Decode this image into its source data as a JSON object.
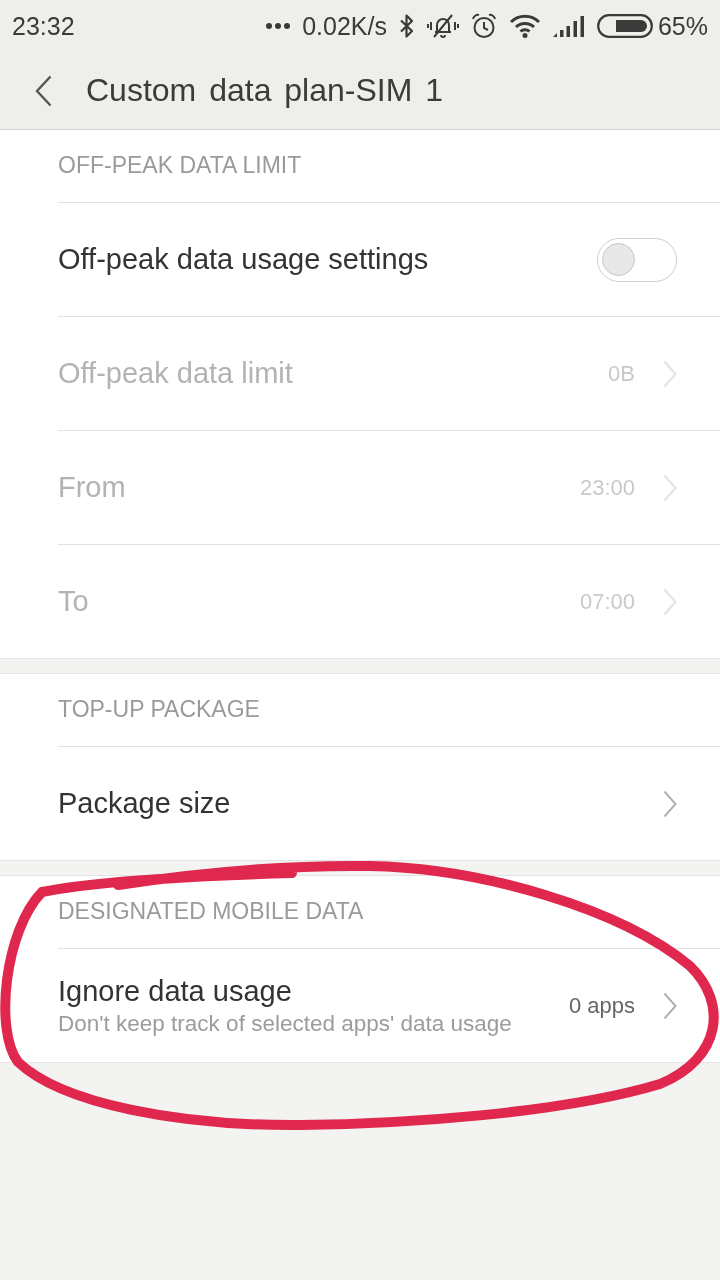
{
  "status_bar": {
    "time": "23:32",
    "net_speed": "0.02K/s",
    "battery": "65%"
  },
  "title_bar": {
    "title": "Custom data plan-SIM 1"
  },
  "sections": [
    {
      "header": "OFF-PEAK DATA LIMIT",
      "rows": [
        {
          "kind": "toggle",
          "label": "Off-peak data usage settings",
          "on": false,
          "disabled": false
        },
        {
          "kind": "link",
          "label": "Off-peak data limit",
          "value": "0B",
          "disabled": true
        },
        {
          "kind": "link",
          "label": "From",
          "value": "23:00",
          "disabled": true
        },
        {
          "kind": "link",
          "label": "To",
          "value": "07:00",
          "disabled": true
        }
      ]
    },
    {
      "header": "TOP-UP PACKAGE",
      "rows": [
        {
          "kind": "link",
          "label": "Package size",
          "disabled": false
        }
      ]
    },
    {
      "header": "DESIGNATED MOBILE DATA",
      "rows": [
        {
          "kind": "link",
          "label": "Ignore data usage",
          "subtitle": "Don't keep track of selected apps' data usage",
          "value": "0 apps",
          "disabled": false
        }
      ]
    }
  ],
  "annotations": [
    {
      "kind": "freehand-ellipse"
    }
  ]
}
